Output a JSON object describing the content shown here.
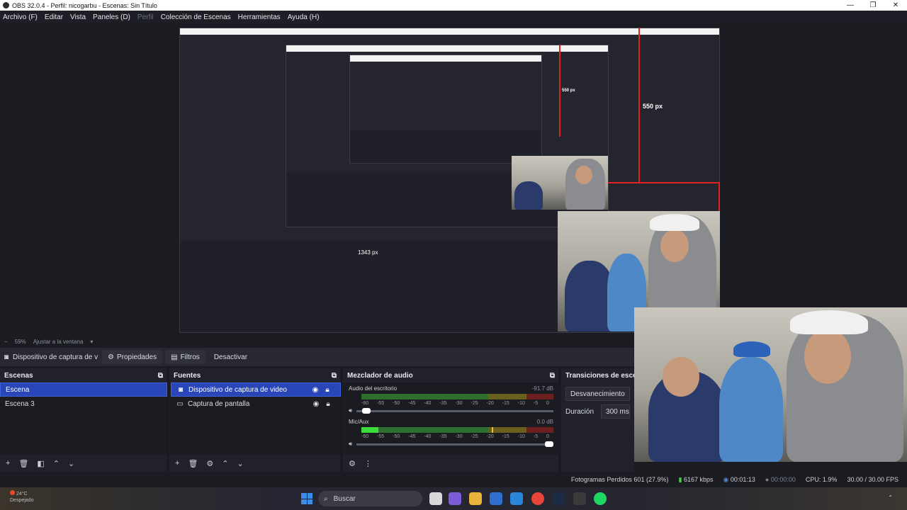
{
  "window": {
    "title": "OBS 32.0.4 - Perfil: nicogarbu - Escenas: Sin Título",
    "minimize_glyph": "—",
    "maximize_glyph": "❐",
    "close_glyph": "✕"
  },
  "menu": {
    "items": [
      "Archivo (F)",
      "Editar",
      "Vista",
      "Paneles (D)",
      "Perfil",
      "Colección de Escenas",
      "Herramientas",
      "Ayuda (H)"
    ]
  },
  "preview": {
    "px_label_large": "550 px",
    "px_label_small": "550 px",
    "px_label_wide": "1343 px"
  },
  "zoom": {
    "value": "59%",
    "fit_label": "Ajustar a la ventana"
  },
  "source_bar": {
    "current_source": "Dispositivo de captura de v",
    "properties_label": "Propiedades",
    "filters_label": "Filtros",
    "deactivate_label": "Desactivar"
  },
  "scenes": {
    "title": "Escenas",
    "items": [
      "Escena",
      "Escena 3"
    ],
    "selected": "Escena"
  },
  "sources": {
    "title": "Fuentes",
    "items": [
      {
        "label": "Dispositivo de captura de video",
        "icon": "camera-icon"
      },
      {
        "label": "Captura de pantalla",
        "icon": "monitor-icon"
      }
    ]
  },
  "mixer": {
    "title": "Mezclador de audio",
    "channels": [
      {
        "name": "Audio del escritorio",
        "db": "-91.7 dB",
        "level": 0.0,
        "peak": 0.0,
        "volume": 0.03
      },
      {
        "name": "Mic/Aux",
        "db": "0.0 dB",
        "level": 0.09,
        "peak": 0.68,
        "volume": 1.0
      }
    ],
    "ticks": [
      "-60",
      "-55",
      "-50",
      "-45",
      "-40",
      "-35",
      "-30",
      "-25",
      "-20",
      "-15",
      "-10",
      "-5",
      "0"
    ]
  },
  "transitions": {
    "title": "Transiciones de escen",
    "selected": "Desvanecimiento",
    "duration_label": "Duración",
    "duration_value": "300 ms"
  },
  "status": {
    "dropped": "Fotogramas Perdidos 601 (27.9%)",
    "bitrate": "6167 kbps",
    "stream_time": "00:01:13",
    "rec_time": "00:00:00",
    "cpu": "CPU: 1.9%",
    "fps": "30.00 / 30.00 FPS"
  },
  "taskbar": {
    "search_placeholder": "Buscar",
    "weather_temp": "24°C",
    "weather_text": "Despejado"
  },
  "colors": {
    "accent": "#2846b8",
    "red_guide": "#e02121",
    "meter_green": "#3cdc3c"
  }
}
